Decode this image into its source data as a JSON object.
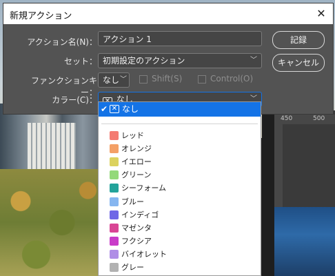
{
  "dialog": {
    "title": "新規アクション",
    "close_icon": "close-icon",
    "name_label": "アクション名(N)：",
    "name_value": "アクション 1",
    "set_label": "セット：",
    "set_value": "初期設定のアクション",
    "fkey_label": "ファンクションキー：",
    "fkey_value": "なし",
    "shift_label": "Shift(S)",
    "control_label": "Control(O)",
    "color_label": "カラー(C)：",
    "color_value": "なし",
    "record_button": "記録",
    "cancel_button": "キャンセル"
  },
  "color_menu": {
    "selected": "なし",
    "items": [
      {
        "label": "レッド",
        "color": "#f47b72"
      },
      {
        "label": "オレンジ",
        "color": "#f4a066"
      },
      {
        "label": "イエロー",
        "color": "#dcd25e"
      },
      {
        "label": "グリーン",
        "color": "#93d97a"
      },
      {
        "label": "シーフォーム",
        "color": "#23a39a"
      },
      {
        "label": "ブルー",
        "color": "#86b6f0"
      },
      {
        "label": "インディゴ",
        "color": "#6f67e6"
      },
      {
        "label": "マゼンタ",
        "color": "#d94595"
      },
      {
        "label": "フクシア",
        "color": "#c93cc9"
      },
      {
        "label": "バイオレット",
        "color": "#b08ee6"
      },
      {
        "label": "グレー",
        "color": "#b2b2b2"
      }
    ]
  },
  "ruler": {
    "tick1": "450",
    "tick2": "500"
  },
  "colors": {
    "accent": "#1473e6",
    "dialog_bg": "#535353"
  }
}
